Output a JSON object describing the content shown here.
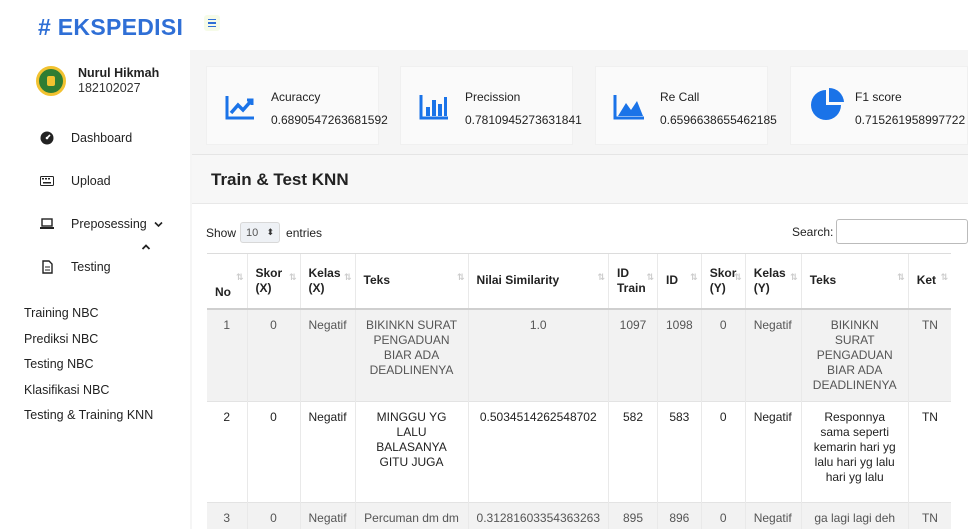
{
  "app": {
    "brand": "# EKSPEDISI"
  },
  "user": {
    "name": "Nurul Hikmah",
    "id": "182102027"
  },
  "sidebar": {
    "items": [
      {
        "label": "Dashboard",
        "icon": "tachometer-icon"
      },
      {
        "label": "Upload",
        "icon": "keyboard-icon"
      },
      {
        "label": "Preposessing",
        "icon": "laptop-icon"
      },
      {
        "label": "Testing",
        "icon": "file-icon"
      }
    ],
    "sublinks": [
      "Training NBC",
      "Prediksi NBC",
      "Testing NBC",
      "Klasifikasi NBC",
      "Testing & Training KNN"
    ]
  },
  "metrics": [
    {
      "label": "Acuraccy",
      "value": "0.6890547263681592",
      "icon": "line-chart-icon"
    },
    {
      "label": "Precission",
      "value": "0.7810945273631841",
      "icon": "bar-chart-icon"
    },
    {
      "label": "Re Call",
      "value": "0.6596638655462185",
      "icon": "area-chart-icon"
    },
    {
      "label": "F1 score",
      "value": "0.715261958997722",
      "icon": "pie-chart-icon"
    }
  ],
  "panel": {
    "title": "Train & Test KNN",
    "show": "Show",
    "entries_value": "10",
    "entries": "entries",
    "search_label": "Search:"
  },
  "table": {
    "headers": [
      "No",
      "Skor (X)",
      "Kelas (X)",
      "Teks",
      "Nilai Similarity",
      "ID Train",
      "ID",
      "Skor (Y)",
      "Kelas (Y)",
      "Teks",
      "Ket"
    ],
    "rows": [
      [
        "1",
        "0",
        "Negatif",
        "BIKINKN SURAT PENGADUAN BIAR ADA DEADLINENYA",
        "1.0",
        "1097",
        "1098",
        "0",
        "Negatif",
        "BIKINKN SURAT PENGADUAN BIAR ADA DEADLINENYA",
        "TN"
      ],
      [
        "2",
        "0",
        "Negatif",
        "MINGGU YG LALU BALASANYA GITU JUGA",
        "0.5034514262548702",
        "582",
        "583",
        "0",
        "Negatif",
        "Responnya sama seperti kemarin hari yg lalu hari yg lalu hari yg lalu",
        "TN"
      ],
      [
        "3",
        "0",
        "Negatif",
        "Percuman dm dm",
        "0.31281603354363263",
        "895",
        "896",
        "0",
        "Negatif",
        "ga lagi lagi deh",
        "TN"
      ]
    ]
  }
}
